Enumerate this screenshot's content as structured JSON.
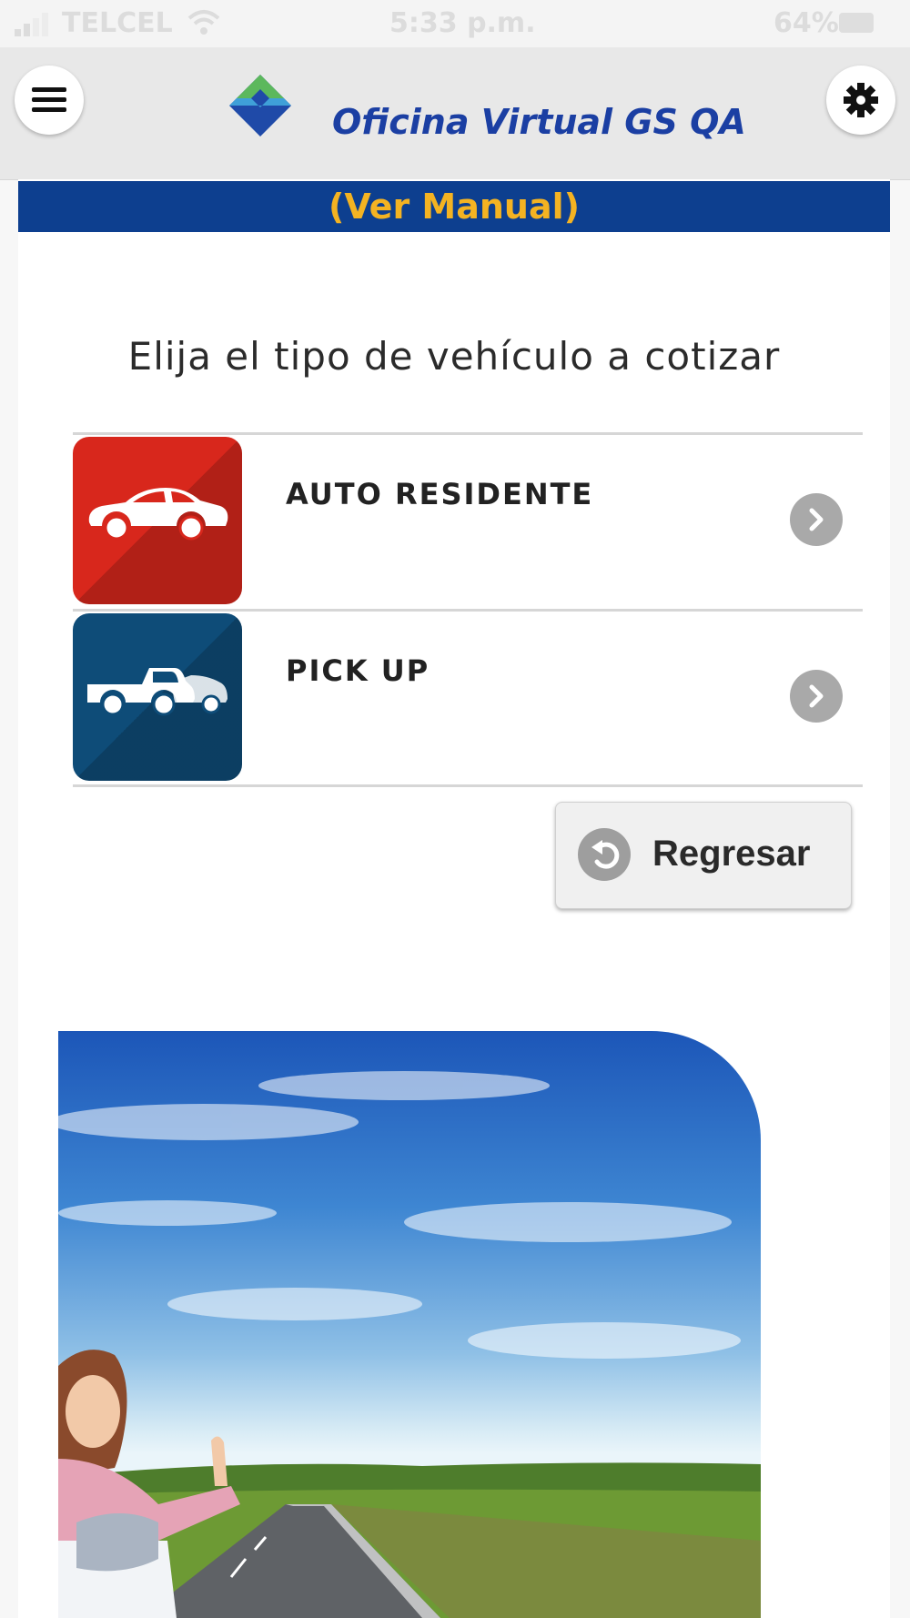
{
  "status_bar": {
    "carrier": "TELCEL",
    "time": "5:33 p.m.",
    "battery": "64%"
  },
  "header": {
    "title": "Oficina Virtual GS QA",
    "menu_icon": "hamburger-menu-icon",
    "settings_icon": "gear-icon"
  },
  "manual_link": "(Ver Manual)",
  "heading": "Elija el tipo de vehículo a cotizar",
  "vehicle_options": [
    {
      "label": "AUTO RESIDENTE",
      "icon": "car-icon",
      "color": "#d8271c"
    },
    {
      "label": "PICK UP",
      "icon": "pickup-truck-icon",
      "color": "#0e4c78"
    }
  ],
  "back_button": {
    "label": "Regresar",
    "icon": "undo-arrow-icon"
  },
  "colors": {
    "brand_blue": "#0d3f8f",
    "manual_text": "#f4b322",
    "title_blue": "#1b3fa3"
  }
}
